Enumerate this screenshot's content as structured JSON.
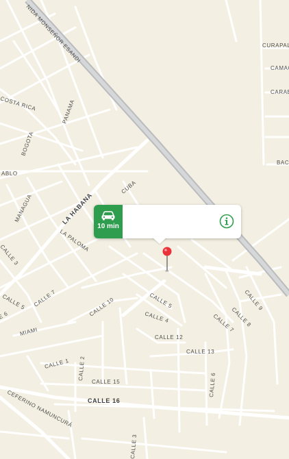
{
  "map": {
    "colors": {
      "land": "#f3efe2",
      "road": "#ffffff",
      "highway": "#c7c9cc",
      "accent": "#2e9e4e",
      "pin": "#e8333a"
    },
    "streets": {
      "avenida": "NIDA MONSEÑOR ESANDI",
      "curapali": "CURAPAL",
      "camac": "CAMAC",
      "carab": "CARAB",
      "bac": "BAC",
      "costa_rica": "COSTA RICA",
      "panama": "PANAMA",
      "bogota": "BOGOTA",
      "ablo": "ABLO",
      "cuba": "CUBA",
      "managua": "MANAGUA",
      "la_habana": "LA HABANA",
      "la_paloma": "LA PALOMA",
      "calle_3": "CALLE 3",
      "calle_7a": "CALLE 7",
      "calle_5a": "CALLE 5",
      "calle_6a": "E 6",
      "miami": "MIAMI",
      "calle_10": "CALLE 10",
      "calle_5b": "CALLE 5",
      "calle_4": "CALLE 4",
      "calle_9": "CALLE 9",
      "calle_8a": "CALLE 8",
      "calle_7b": "CALLE 7",
      "calle_12": "CALLE 12",
      "calle_13": "CALLE 13",
      "calle_1": "CALLE 1",
      "calle_2": "CALLE 2",
      "calle_15": "CALLE 15",
      "calle_6b": "CALLE 6",
      "calle_16": "CALLE 16",
      "ceferino": "CEFERINO NAMUNCURÁ",
      "calle_3b": "CALLE 3"
    }
  },
  "callout": {
    "eta": "10 min",
    "vehicle_icon": "car-icon",
    "info_icon": "info-icon"
  },
  "pin": {
    "icon": "map-pin-icon"
  }
}
